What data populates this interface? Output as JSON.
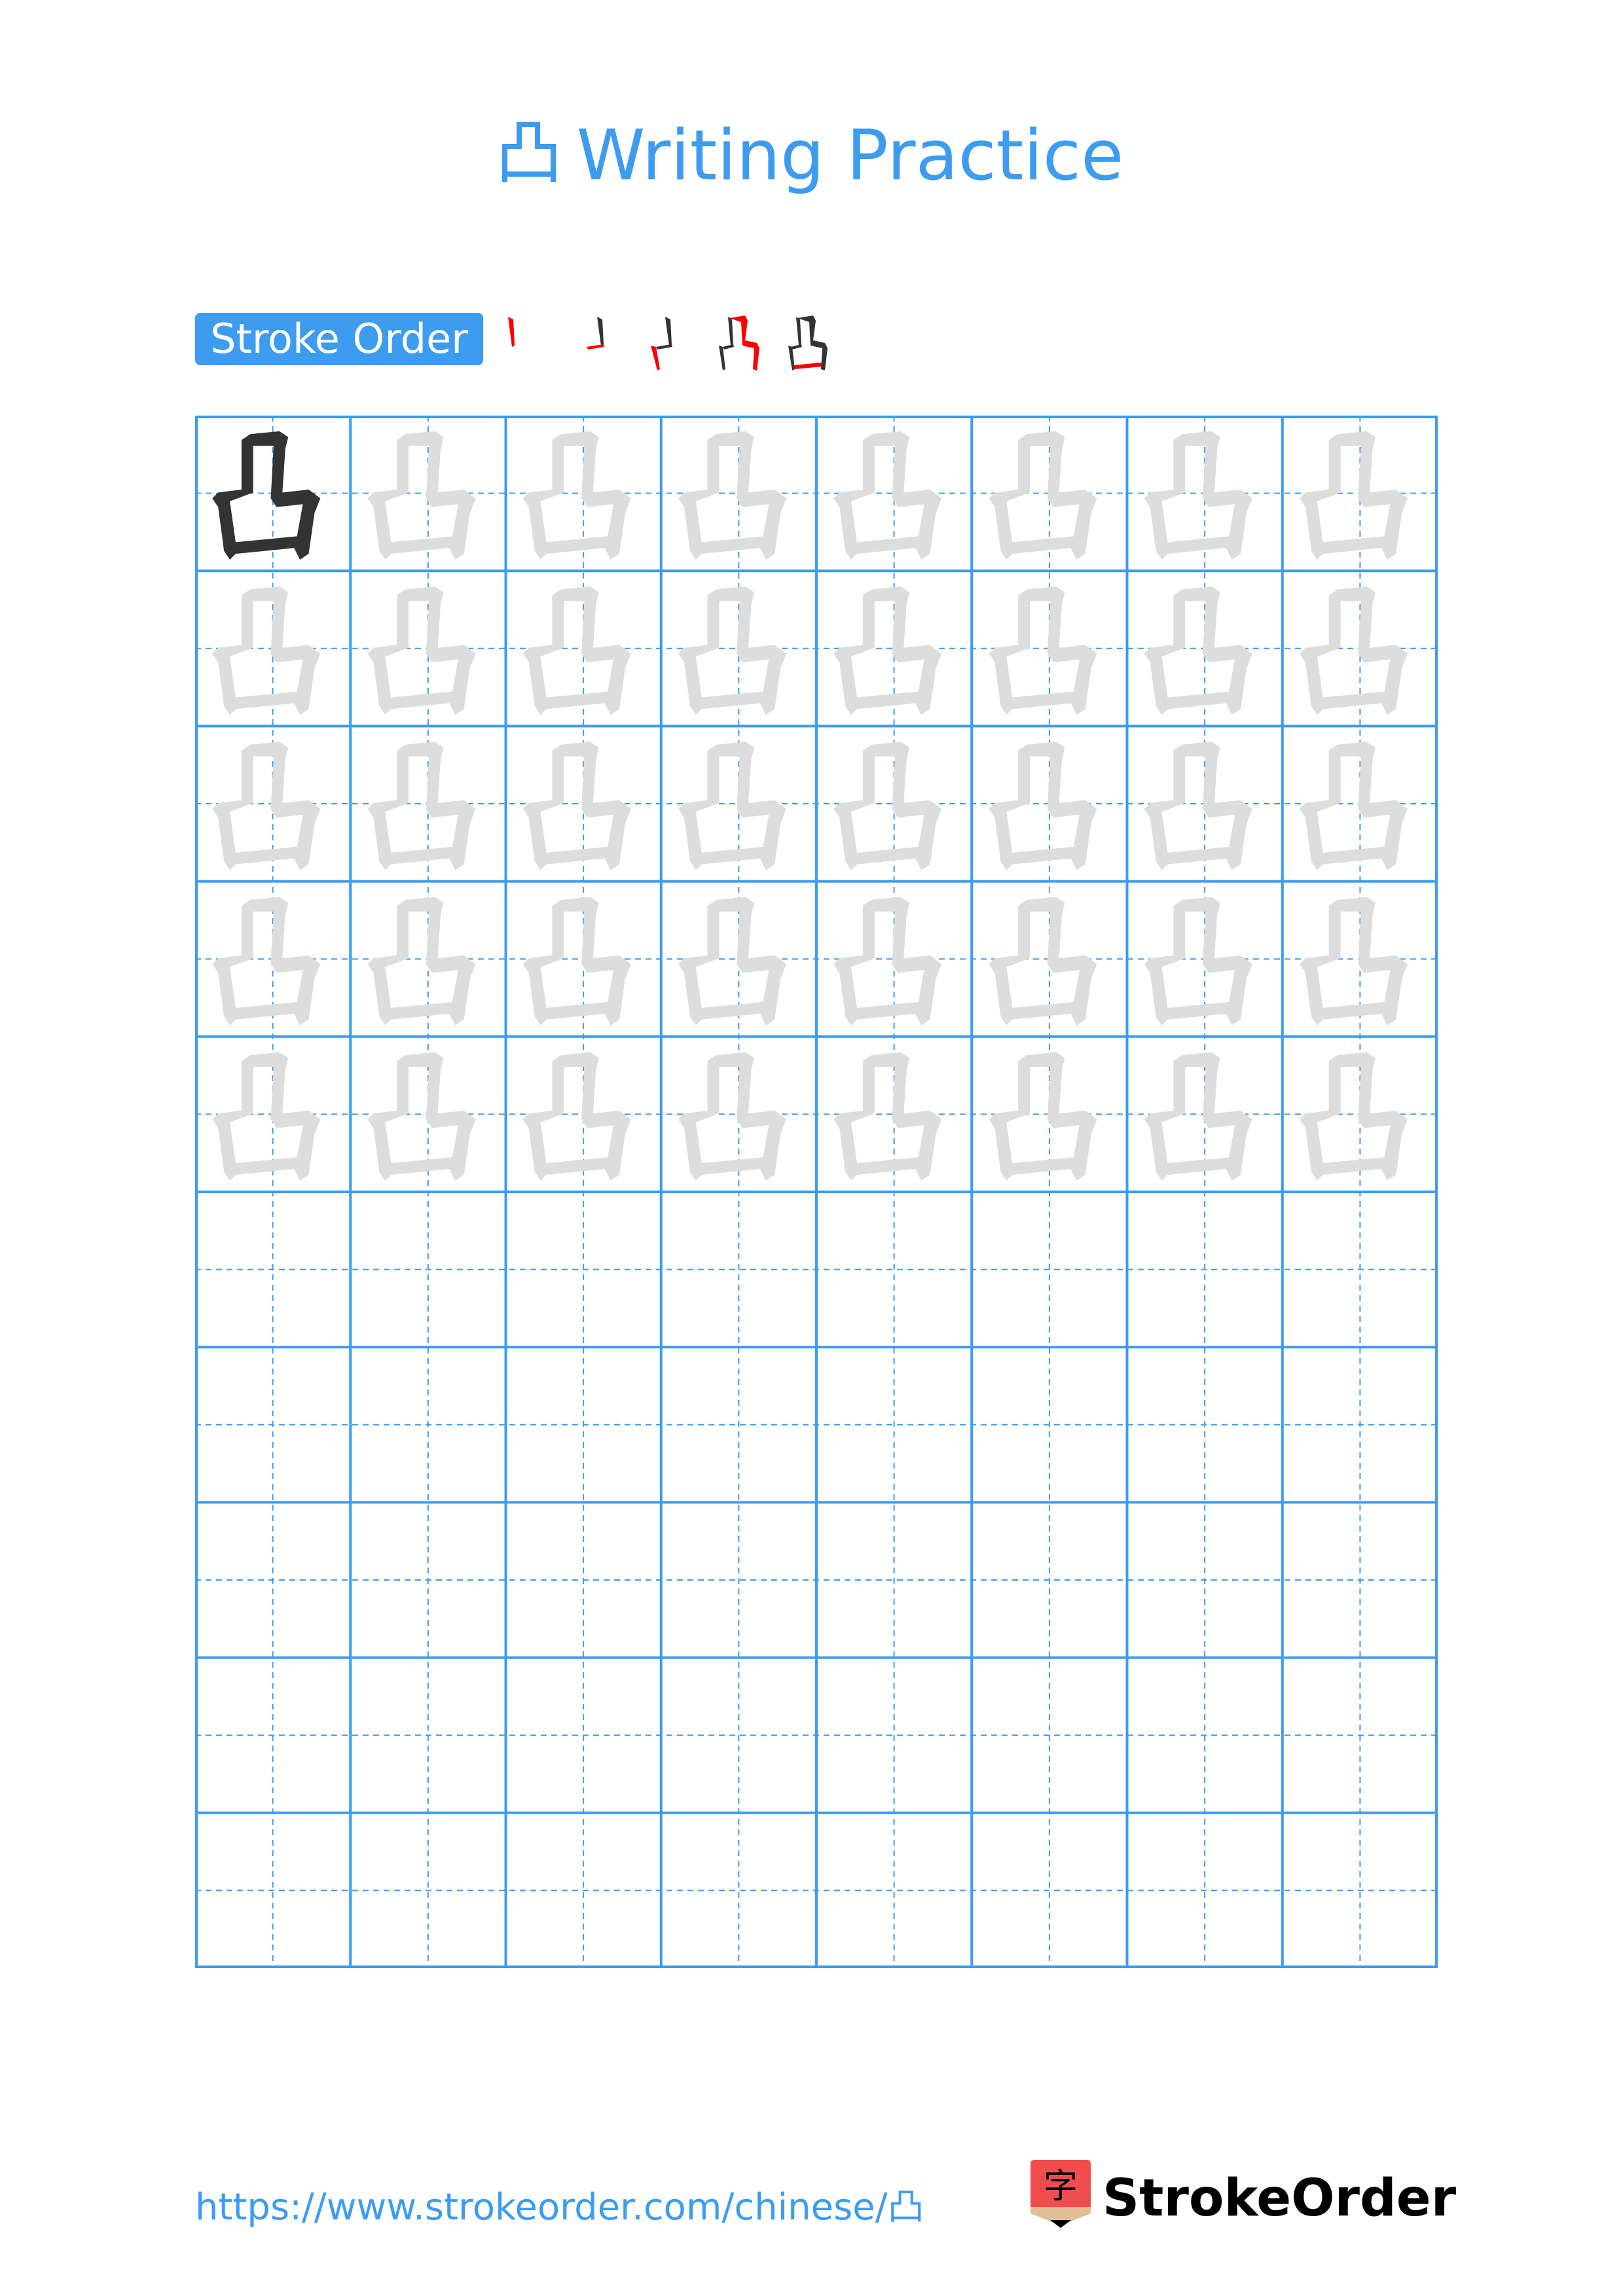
{
  "page": {
    "character": "凸",
    "title_suffix": "Writing Practice",
    "title_full": "凸 Writing Practice"
  },
  "stroke_order": {
    "label": "Stroke Order",
    "stroke_count": 5,
    "steps": [
      {
        "step": 1,
        "description": "vertical stroke (left of top)"
      },
      {
        "step": 2,
        "description": "horizontal stroke"
      },
      {
        "step": 3,
        "description": "vertical stroke (lower left)"
      },
      {
        "step": 4,
        "description": "horizontal-vertical turning stroke"
      },
      {
        "step": 5,
        "description": "bottom horizontal stroke"
      }
    ],
    "current_stroke_color": "#ff0000",
    "previous_stroke_color": "#333333"
  },
  "practice_grid": {
    "columns": 8,
    "rows": 10,
    "model_cells": 1,
    "traced_rows": 5,
    "blank_rows": 5,
    "model_color": "#333333",
    "trace_color": "#dddddd",
    "line_color": "#3d9bf0"
  },
  "footer": {
    "url": "https://www.strokeorder.com/chinese/凸",
    "brand_name": "StrokeOrder",
    "brand_icon_char": "字"
  },
  "colors": {
    "accent": "#3d9bf0",
    "brand_red": "#f04e4e",
    "brand_tan": "#dfbf95"
  }
}
